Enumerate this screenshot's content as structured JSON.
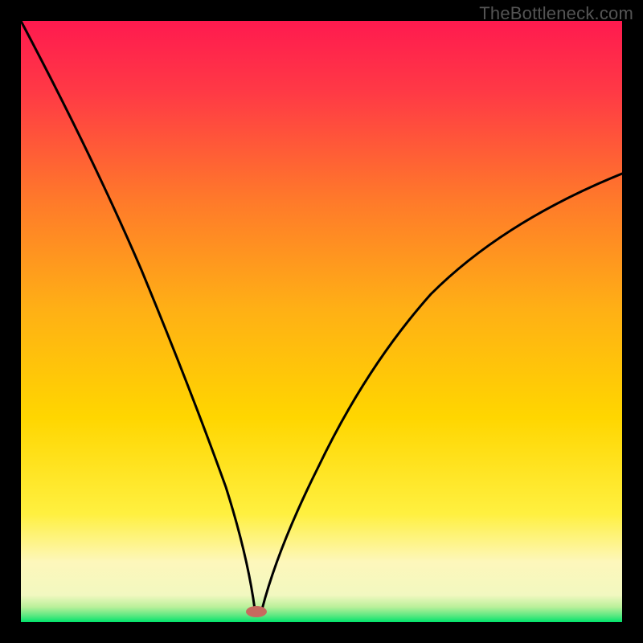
{
  "watermark": "TheBottleneck.com",
  "chart_data": {
    "type": "line",
    "title": "",
    "xlabel": "",
    "ylabel": "",
    "xlim": [
      0,
      100
    ],
    "ylim": [
      0,
      100
    ],
    "background_gradient": {
      "top_color": "#ff1a4f",
      "mid_color": "#ffd600",
      "bottom_band_color": "#fdf7bb",
      "bottom_edge_color": "#00e36b"
    },
    "series": [
      {
        "name": "bottleneck-curve",
        "x": [
          0,
          5,
          10,
          15,
          20,
          25,
          30,
          34,
          36,
          38,
          39,
          40,
          42,
          45,
          50,
          55,
          60,
          65,
          70,
          75,
          80,
          85,
          90,
          95,
          100
        ],
        "values": [
          100,
          86,
          72,
          58,
          45,
          33,
          22,
          9,
          4,
          1,
          0,
          1,
          6,
          14,
          26,
          36,
          44,
          51,
          56,
          61,
          65,
          68,
          71,
          73,
          75
        ]
      }
    ],
    "marker": {
      "name": "bottleneck-point",
      "x": 39,
      "y": 1,
      "color": "#c76a5f"
    }
  }
}
